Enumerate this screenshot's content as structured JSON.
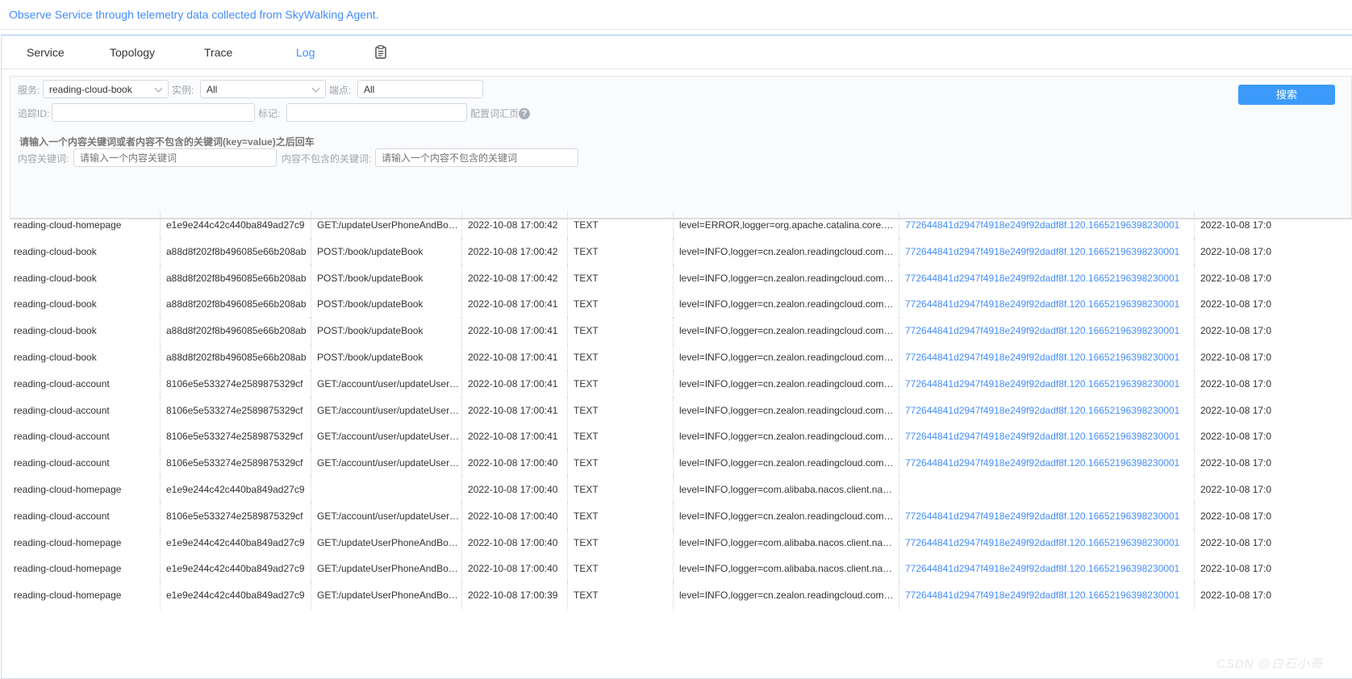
{
  "banner": {
    "text": "Observe Service through telemetry data collected from SkyWalking Agent."
  },
  "tabs": [
    {
      "label": "Service"
    },
    {
      "label": "Topology"
    },
    {
      "label": "Trace"
    },
    {
      "label": "Log"
    }
  ],
  "active_tab": "Log",
  "filters": {
    "service_label": "服务:",
    "service_value": "reading-cloud-book",
    "instance_label": "实例:",
    "instance_value": "All",
    "endpoint_label": "端点:",
    "endpoint_value": "All",
    "search_button": "搜索",
    "trace_id_label": "追踪ID:",
    "trace_id_value": "",
    "tags_label": "标记:",
    "tags_value": "",
    "config_link": "配置词汇页",
    "help_glyph": "?",
    "hint": "请输入一个内容关键词或者内容不包含的关键词(key=value)之后回车",
    "keywords_label": "内容关键词:",
    "keywords_placeholder": "请输入一个内容关键词",
    "exclude_label": "内容不包含的关键词:",
    "exclude_placeholder": "请输入一个内容不包含的关键词"
  },
  "logs": [
    {
      "service": "reading-cloud-homepage",
      "instance": "e1e9e244c42c440ba849ad27c9",
      "endpoint": "GET:/updateUserPhoneAndBookInfo",
      "time": "2022-10-08 17:00:42",
      "type": "TEXT",
      "tags": "level=ERROR,logger=org.apache.catalina.core.ContainerBase",
      "trace_id": "772644841d2947f4918e249f92dadf8f.120.16652196398230001",
      "end_time": "2022-10-08 17:0"
    },
    {
      "service": "reading-cloud-book",
      "instance": "a88d8f202f8b496085e66b208ab",
      "endpoint": "POST:/book/updateBook",
      "time": "2022-10-08 17:00:42",
      "type": "TEXT",
      "tags": "level=INFO,logger=cn.zealon.readingcloud.common",
      "trace_id": "772644841d2947f4918e249f92dadf8f.120.16652196398230001",
      "end_time": "2022-10-08 17:0"
    },
    {
      "service": "reading-cloud-book",
      "instance": "a88d8f202f8b496085e66b208ab",
      "endpoint": "POST:/book/updateBook",
      "time": "2022-10-08 17:00:42",
      "type": "TEXT",
      "tags": "level=INFO,logger=cn.zealon.readingcloud.common",
      "trace_id": "772644841d2947f4918e249f92dadf8f.120.16652196398230001",
      "end_time": "2022-10-08 17:0"
    },
    {
      "service": "reading-cloud-book",
      "instance": "a88d8f202f8b496085e66b208ab",
      "endpoint": "POST:/book/updateBook",
      "time": "2022-10-08 17:00:41",
      "type": "TEXT",
      "tags": "level=INFO,logger=cn.zealon.readingcloud.common",
      "trace_id": "772644841d2947f4918e249f92dadf8f.120.16652196398230001",
      "end_time": "2022-10-08 17:0"
    },
    {
      "service": "reading-cloud-book",
      "instance": "a88d8f202f8b496085e66b208ab",
      "endpoint": "POST:/book/updateBook",
      "time": "2022-10-08 17:00:41",
      "type": "TEXT",
      "tags": "level=INFO,logger=cn.zealon.readingcloud.common",
      "trace_id": "772644841d2947f4918e249f92dadf8f.120.16652196398230001",
      "end_time": "2022-10-08 17:0"
    },
    {
      "service": "reading-cloud-book",
      "instance": "a88d8f202f8b496085e66b208ab",
      "endpoint": "POST:/book/updateBook",
      "time": "2022-10-08 17:00:41",
      "type": "TEXT",
      "tags": "level=INFO,logger=cn.zealon.readingcloud.common",
      "trace_id": "772644841d2947f4918e249f92dadf8f.120.16652196398230001",
      "end_time": "2022-10-08 17:0"
    },
    {
      "service": "reading-cloud-account",
      "instance": "8106e5e533274e2589875329cf",
      "endpoint": "GET:/account/user/updateUserPhone",
      "time": "2022-10-08 17:00:41",
      "type": "TEXT",
      "tags": "level=INFO,logger=cn.zealon.readingcloud.common",
      "trace_id": "772644841d2947f4918e249f92dadf8f.120.16652196398230001",
      "end_time": "2022-10-08 17:0"
    },
    {
      "service": "reading-cloud-account",
      "instance": "8106e5e533274e2589875329cf",
      "endpoint": "GET:/account/user/updateUserPhone",
      "time": "2022-10-08 17:00:41",
      "type": "TEXT",
      "tags": "level=INFO,logger=cn.zealon.readingcloud.common",
      "trace_id": "772644841d2947f4918e249f92dadf8f.120.16652196398230001",
      "end_time": "2022-10-08 17:0"
    },
    {
      "service": "reading-cloud-account",
      "instance": "8106e5e533274e2589875329cf",
      "endpoint": "GET:/account/user/updateUserPhone",
      "time": "2022-10-08 17:00:41",
      "type": "TEXT",
      "tags": "level=INFO,logger=cn.zealon.readingcloud.common",
      "trace_id": "772644841d2947f4918e249f92dadf8f.120.16652196398230001",
      "end_time": "2022-10-08 17:0"
    },
    {
      "service": "reading-cloud-account",
      "instance": "8106e5e533274e2589875329cf",
      "endpoint": "GET:/account/user/updateUserPhone",
      "time": "2022-10-08 17:00:40",
      "type": "TEXT",
      "tags": "level=INFO,logger=cn.zealon.readingcloud.common",
      "trace_id": "772644841d2947f4918e249f92dadf8f.120.16652196398230001",
      "end_time": "2022-10-08 17:0"
    },
    {
      "service": "reading-cloud-homepage",
      "instance": "e1e9e244c42c440ba849ad27c9",
      "endpoint": "",
      "time": "2022-10-08 17:00:40",
      "type": "TEXT",
      "tags": "level=INFO,logger=com.alibaba.nacos.client.naming",
      "trace_id": "",
      "end_time": "2022-10-08 17:0"
    },
    {
      "service": "reading-cloud-account",
      "instance": "8106e5e533274e2589875329cf",
      "endpoint": "GET:/account/user/updateUserPhone",
      "time": "2022-10-08 17:00:40",
      "type": "TEXT",
      "tags": "level=INFO,logger=cn.zealon.readingcloud.common",
      "trace_id": "772644841d2947f4918e249f92dadf8f.120.16652196398230001",
      "end_time": "2022-10-08 17:0"
    },
    {
      "service": "reading-cloud-homepage",
      "instance": "e1e9e244c42c440ba849ad27c9",
      "endpoint": "GET:/updateUserPhoneAndBookInfo",
      "time": "2022-10-08 17:00:40",
      "type": "TEXT",
      "tags": "level=INFO,logger=com.alibaba.nacos.client.naming",
      "trace_id": "772644841d2947f4918e249f92dadf8f.120.16652196398230001",
      "end_time": "2022-10-08 17:0"
    },
    {
      "service": "reading-cloud-homepage",
      "instance": "e1e9e244c42c440ba849ad27c9",
      "endpoint": "GET:/updateUserPhoneAndBookInfo",
      "time": "2022-10-08 17:00:40",
      "type": "TEXT",
      "tags": "level=INFO,logger=com.alibaba.nacos.client.naming",
      "trace_id": "772644841d2947f4918e249f92dadf8f.120.16652196398230001",
      "end_time": "2022-10-08 17:0"
    },
    {
      "service": "reading-cloud-homepage",
      "instance": "e1e9e244c42c440ba849ad27c9",
      "endpoint": "GET:/updateUserPhoneAndBookInfo",
      "time": "2022-10-08 17:00:39",
      "type": "TEXT",
      "tags": "level=INFO,logger=cn.zealon.readingcloud.common",
      "trace_id": "772644841d2947f4918e249f92dadf8f.120.16652196398230001",
      "end_time": "2022-10-08 17:0"
    }
  ],
  "watermark": "CSDN @白石小哥",
  "colors": {
    "accent": "#448dfe",
    "button": "#3c9bfa"
  },
  "icons": {
    "tab_extra": "clipboard-icon",
    "help": "help-icon",
    "dropdown": "chevron-down-icon"
  }
}
